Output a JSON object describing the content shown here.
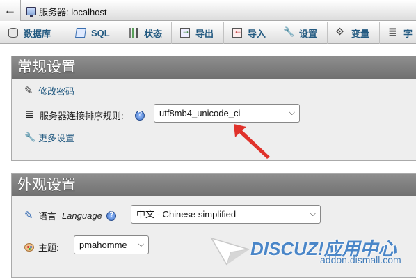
{
  "breadcrumb": {
    "back_symbol": "←",
    "server_label": "服务器: localhost"
  },
  "tabs": [
    {
      "label": "数据库",
      "icon": "database-icon"
    },
    {
      "label": "SQL",
      "icon": "sql-icon"
    },
    {
      "label": "状态",
      "icon": "status-icon"
    },
    {
      "label": "导出",
      "icon": "export-icon"
    },
    {
      "label": "导入",
      "icon": "import-icon"
    },
    {
      "label": "设置",
      "icon": "settings-icon"
    },
    {
      "label": "变量",
      "icon": "variables-icon"
    },
    {
      "label": "字",
      "icon": "charset-icon"
    }
  ],
  "general": {
    "title": "常规设置",
    "change_password": "修改密码",
    "collation_label": "服务器连接排序规则:",
    "collation_value": "utf8mb4_unicode_ci",
    "more_settings": "更多设置"
  },
  "appearance": {
    "title": "外观设置",
    "language_label": "语言 - ",
    "language_label_en": "Language",
    "language_value": "中文 - Chinese simplified",
    "theme_label": "主题:",
    "theme_value": "pmahomme"
  },
  "watermark": {
    "brand": "DISCUZ!应用中心",
    "sub": "addon.dismall.com"
  },
  "colors": {
    "link": "#235a81",
    "panel_header": "#7e7e7e",
    "arrow": "#e0322b"
  }
}
